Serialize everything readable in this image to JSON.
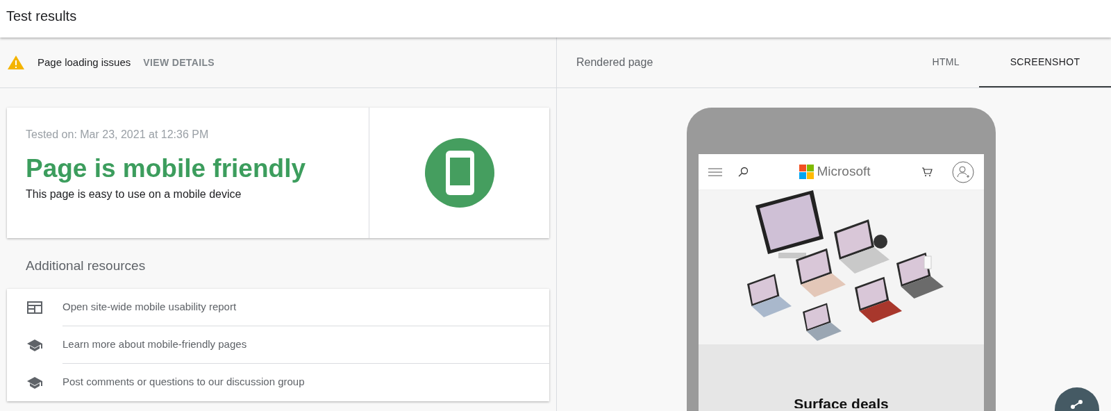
{
  "header": {
    "title": "Test results"
  },
  "issues_bar": {
    "label": "Page loading issues",
    "action": "VIEW DETAILS"
  },
  "result_card": {
    "tested_on": "Tested on: Mar 23, 2021 at 12:36 PM",
    "verdict": "Page is mobile friendly",
    "description": "This page is easy to use on a mobile device"
  },
  "resources": {
    "title": "Additional resources",
    "items": [
      {
        "kind": "report",
        "label": "Open site-wide mobile usability report"
      },
      {
        "kind": "learn",
        "label": "Learn more about mobile-friendly pages"
      },
      {
        "kind": "learn",
        "label": "Post comments or questions to our discussion group"
      }
    ]
  },
  "rendered": {
    "title": "Rendered page",
    "tabs": [
      {
        "label": "HTML",
        "selected": false
      },
      {
        "label": "SCREENSHOT",
        "selected": true
      }
    ],
    "site": {
      "brand": "Microsoft",
      "heading": "Surface deals"
    }
  }
}
